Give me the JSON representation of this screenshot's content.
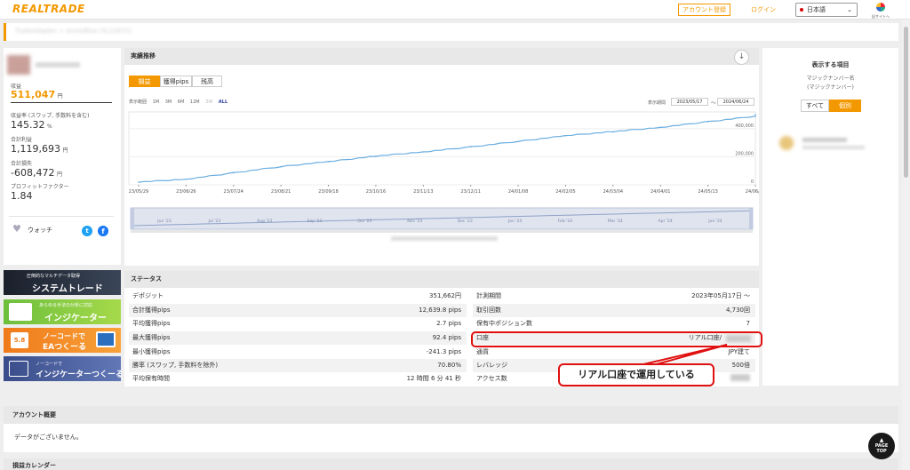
{
  "header": {
    "logo": "REALTRADE",
    "signup_label": "アカウント登録",
    "login_label": "ログイン",
    "language": "日本語",
    "old_site_label": "旧サイトへ"
  },
  "breadcrumb": "TradeAdapter > AnnieBlue (5L12672)",
  "profile": {
    "profit_label": "収益",
    "profit_value": "511,047",
    "profit_unit": "円",
    "rate_label": "収益率 (スワップ, 手数料を含む)",
    "rate_value": "145.32",
    "rate_unit": "%",
    "total_profit_label": "合計利益",
    "total_profit_value": "1,119,693",
    "total_profit_unit": "円",
    "total_loss_label": "合計損失",
    "total_loss_value": "-608,472",
    "total_loss_unit": "円",
    "pf_label": "プロフィットファクター",
    "pf_value": "1.84",
    "watch_label": "ウォッチ",
    "twitter_icon": "t",
    "facebook_icon": "f"
  },
  "ads": [
    {
      "sub": "圧倒的なマルチデータ取得",
      "main": "システムトレード"
    },
    {
      "sub": "あらゆる手法の分析に対応",
      "main": "インジケーター"
    },
    {
      "sub": "ノーコードで",
      "main": "EAつくーる"
    },
    {
      "sub": "ノーコードで",
      "main": "インジケーターつくーる"
    }
  ],
  "performance": {
    "title": "実績推移",
    "tabs": [
      "損益",
      "獲得pips",
      "残高"
    ],
    "active_tab": 0,
    "ranges": [
      "表示範囲",
      "1M",
      "3M",
      "6M",
      "12M",
      "3W",
      "ALL"
    ],
    "period_label": "表示期間",
    "date_from": "2023/05/17",
    "tilde": "～",
    "date_to": "2024/06/24"
  },
  "chart_data": {
    "type": "line",
    "title": "",
    "xlabel": "",
    "ylabel": "",
    "x": [
      "23/05/29",
      "23/06/26",
      "23/07/24",
      "23/08/21",
      "23/09/18",
      "23/10/16",
      "23/11/13",
      "23/12/11",
      "24/01/08",
      "24/02/05",
      "24/03/04",
      "24/04/01",
      "24/05/13",
      "24/06/17"
    ],
    "series": [
      {
        "values": [
          20000,
          40000,
          85000,
          130000,
          165000,
          205000,
          235000,
          270000,
          310000,
          350000,
          380000,
          410000,
          450000,
          490000
        ]
      }
    ],
    "yticks": [
      "0",
      "200,000",
      "400,000"
    ],
    "ylim": [
      0,
      520000
    ],
    "nav_labels": [
      "Jun '23",
      "Jul '23",
      "Aug '23",
      "Sep '23",
      "Oct '23",
      "Nov '23",
      "Dec '23",
      "Jan '24",
      "Feb '24",
      "Mar '24",
      "Apr '24",
      "Jun '24"
    ],
    "color": "#6baee0"
  },
  "display": {
    "title": "表示する項目",
    "magic_label": "マジックナンバー名",
    "magic_sub": "(マジックナンバー)",
    "all_label": "すべて",
    "custom_label": "個別"
  },
  "status": {
    "title": "ステータス",
    "left": [
      {
        "k": "デポジット",
        "v": "351,662円"
      },
      {
        "k": "合計獲得pips",
        "v": "12,639.8 pips"
      },
      {
        "k": "平均獲得pips",
        "v": "2.7 pips"
      },
      {
        "k": "最大獲得pips",
        "v": "92.4 pips"
      },
      {
        "k": "最小獲得pips",
        "v": "-241.3 pips"
      },
      {
        "k": "勝率 (スワップ, 手数料を除外)",
        "v": "70.80%"
      },
      {
        "k": "平均保有時間",
        "v": "12 時間 6 分 41 秒"
      }
    ],
    "right": [
      {
        "k": "計測期間",
        "v": "2023年05月17日 ～"
      },
      {
        "k": "取引回数",
        "v": "4,730回"
      },
      {
        "k": "保有中ポジション数",
        "v": "7"
      },
      {
        "k": "口座",
        "v": "リアル口座/"
      },
      {
        "k": "通貨",
        "v": "JPY建て"
      },
      {
        "k": "レバレッジ",
        "v": "500倍"
      },
      {
        "k": "アクセス数",
        "v": ""
      }
    ]
  },
  "annotation": "リアル口座で運用している",
  "account_summary": {
    "title": "アカウント概要",
    "empty": "データがございません。"
  },
  "calendar": {
    "title": "損益カレンダー"
  },
  "page_top": "PAGE TOP"
}
